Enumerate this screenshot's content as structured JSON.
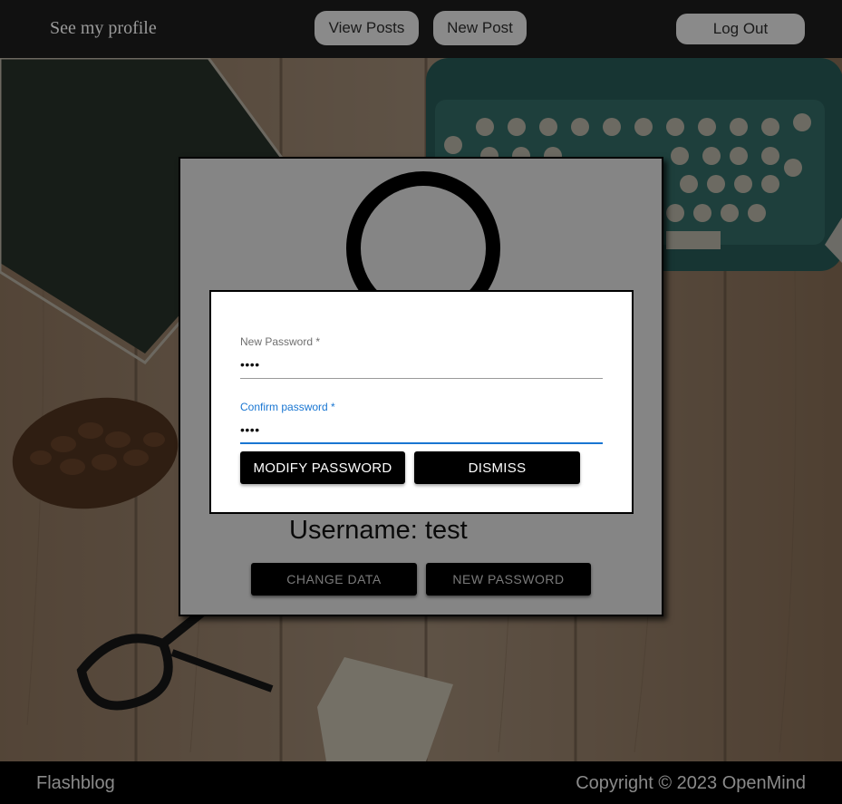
{
  "header": {
    "profile_link": "See my profile",
    "view_posts": "View Posts",
    "new_post": "New Post",
    "log_out": "Log Out"
  },
  "profile": {
    "username_label": "Username: test",
    "change_data": "CHANGE DATA",
    "new_password": "NEW PASSWORD"
  },
  "modal": {
    "new_password_label": "New Password *",
    "new_password_value": "••••",
    "confirm_password_label": "Confirm password *",
    "confirm_password_value": "••••",
    "modify_button": "MODIFY PASSWORD",
    "dismiss_button": "DISMISS"
  },
  "footer": {
    "brand": "Flashblog",
    "copyright": "Copyright © 2023 OpenMind"
  },
  "colors": {
    "accent": "#1976d2",
    "header_bg": "#111111",
    "button_bg": "#000000"
  }
}
